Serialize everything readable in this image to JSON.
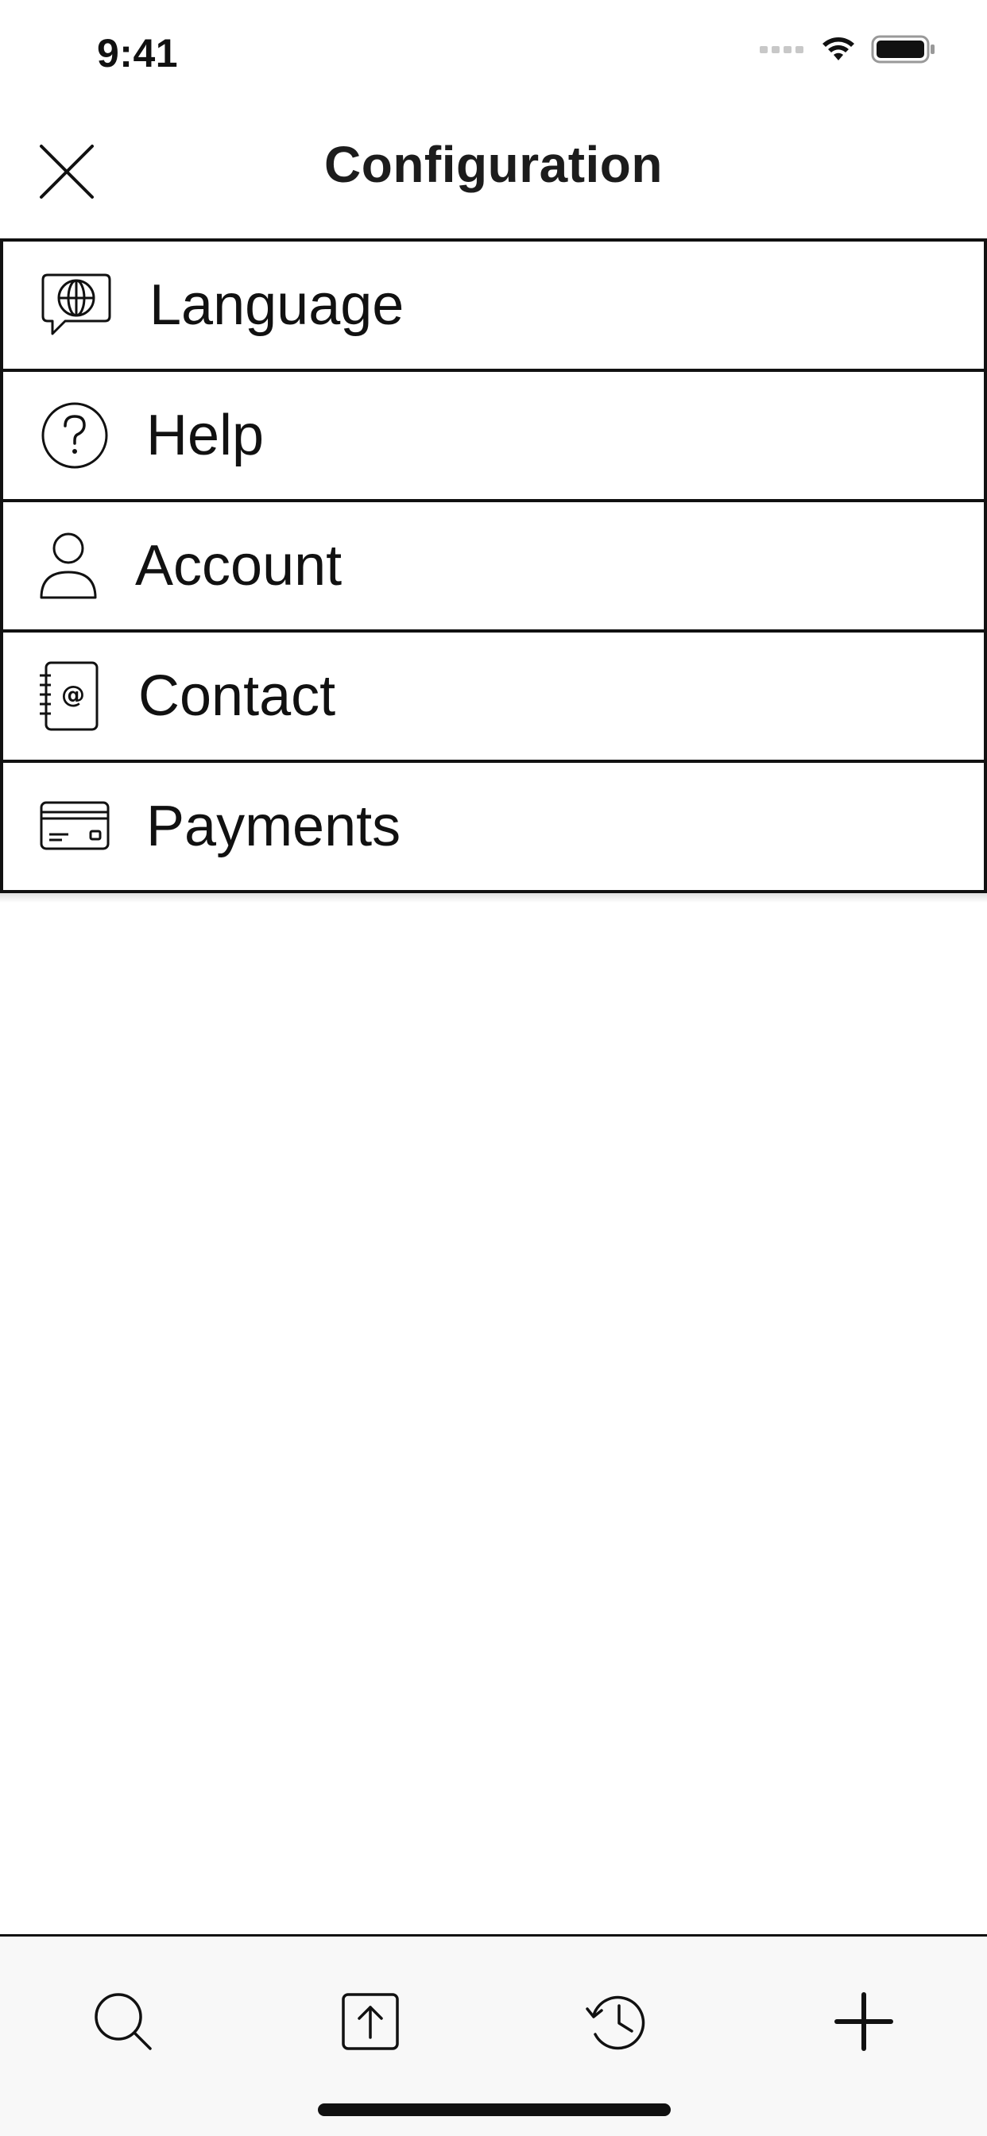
{
  "status_bar": {
    "time": "9:41",
    "icons": [
      "signal-dots-icon",
      "wifi-icon",
      "battery-icon"
    ]
  },
  "header": {
    "title": "Configuration",
    "close_icon": "close-icon"
  },
  "menu": {
    "items": [
      {
        "label": "Language",
        "icon": "language-chat-globe-icon"
      },
      {
        "label": "Help",
        "icon": "help-question-icon"
      },
      {
        "label": "Account",
        "icon": "user-icon"
      },
      {
        "label": "Contact",
        "icon": "address-book-icon"
      },
      {
        "label": "Payments",
        "icon": "credit-card-icon"
      }
    ]
  },
  "tab_bar": {
    "items": [
      {
        "icon": "search-icon"
      },
      {
        "icon": "upload-icon"
      },
      {
        "icon": "history-icon"
      },
      {
        "icon": "add-icon"
      }
    ]
  },
  "colors": {
    "background": "#ffffff",
    "foreground": "#111111",
    "tab_bar_background": "#f8f8f8"
  }
}
